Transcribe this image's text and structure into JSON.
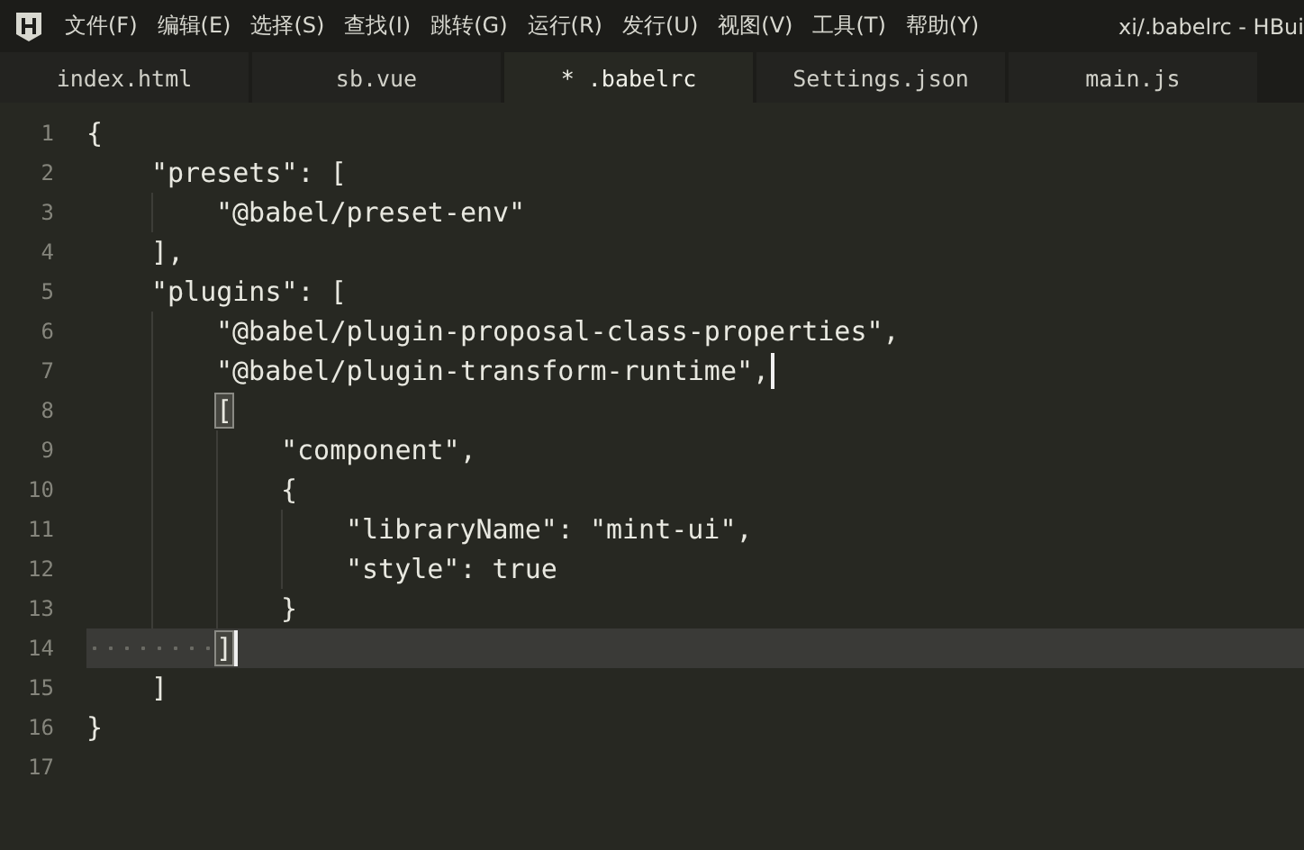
{
  "window": {
    "title": "xi/.babelrc - HBui"
  },
  "menu": [
    "文件(F)",
    "编辑(E)",
    "选择(S)",
    "查找(I)",
    "跳转(G)",
    "运行(R)",
    "发行(U)",
    "视图(V)",
    "工具(T)",
    "帮助(Y)"
  ],
  "tabs": [
    {
      "label": "index.html",
      "selected": false
    },
    {
      "label": "sb.vue",
      "selected": false
    },
    {
      "label": "* .babelrc",
      "selected": true
    },
    {
      "label": "Settings.json",
      "selected": false
    },
    {
      "label": "main.js",
      "selected": false
    }
  ],
  "editor": {
    "lines": [
      {
        "number": "1",
        "text": "{",
        "current": false,
        "bracket_match": false,
        "cursor": false
      },
      {
        "number": "2",
        "text": "    \"presets\": [",
        "current": false,
        "bracket_match": false,
        "cursor": false
      },
      {
        "number": "3",
        "text": "        \"@babel/preset-env\"",
        "current": false,
        "bracket_match": false,
        "cursor": false
      },
      {
        "number": "4",
        "text": "    ],",
        "current": false,
        "bracket_match": false,
        "cursor": false
      },
      {
        "number": "5",
        "text": "    \"plugins\": [",
        "current": false,
        "bracket_match": false,
        "cursor": false
      },
      {
        "number": "6",
        "text": "        \"@babel/plugin-proposal-class-properties\",",
        "current": false,
        "bracket_match": false,
        "cursor": false
      },
      {
        "number": "7",
        "text": "        \"@babel/plugin-transform-runtime\",",
        "current": false,
        "bracket_match": false,
        "cursor": true
      },
      {
        "number": "8",
        "text": "        [",
        "current": false,
        "bracket_match": true,
        "cursor": false
      },
      {
        "number": "9",
        "text": "            \"component\",",
        "current": false,
        "bracket_match": false,
        "cursor": false
      },
      {
        "number": "10",
        "text": "            {",
        "current": false,
        "bracket_match": false,
        "cursor": false
      },
      {
        "number": "11",
        "text": "                \"libraryName\": \"mint-ui\",",
        "current": false,
        "bracket_match": false,
        "cursor": false
      },
      {
        "number": "12",
        "text": "                \"style\": true",
        "current": false,
        "bracket_match": false,
        "cursor": false
      },
      {
        "number": "13",
        "text": "            }",
        "current": false,
        "bracket_match": false,
        "cursor": false
      },
      {
        "number": "14",
        "text": "        ]",
        "current": true,
        "bracket_match": true,
        "cursor": true
      },
      {
        "number": "15",
        "text": "    ]",
        "current": false,
        "bracket_match": false,
        "cursor": false
      },
      {
        "number": "16",
        "text": "}",
        "current": false,
        "bracket_match": false,
        "cursor": false
      },
      {
        "number": "17"
      }
    ]
  }
}
